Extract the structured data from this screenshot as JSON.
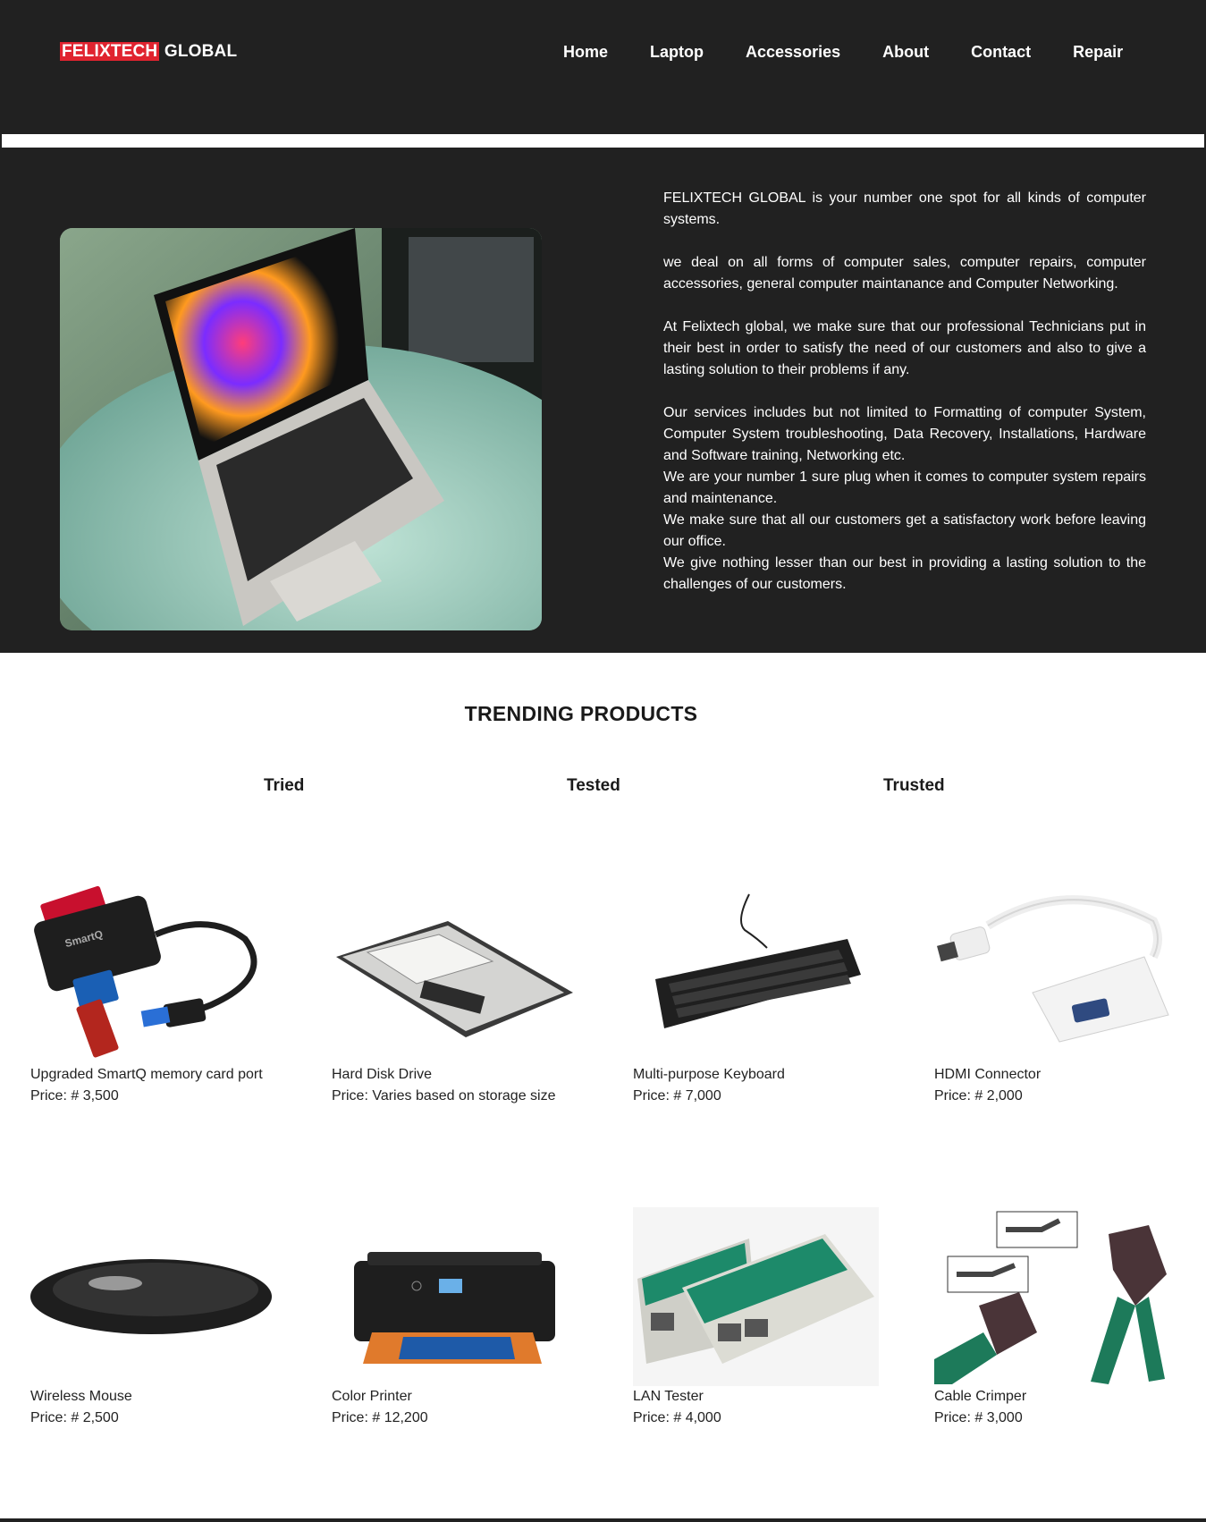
{
  "header": {
    "logo_brand": "FELIXTECH",
    "logo_rest": "GLOBAL",
    "nav": [
      "Home",
      "Laptop",
      "Accessories",
      "About",
      "Contact",
      "Repair"
    ]
  },
  "hero": {
    "paragraphs": [
      "FELIXTECH GLOBAL is your number one spot for all kinds of computer systems.",
      "we deal on all forms of computer sales, computer repairs, computer accessories, general computer maintanance and Computer Networking.",
      "At Felixtech global, we make sure that our professional Technicians put in their best in order to satisfy the need of our customers and also to give a lasting solution to their problems if any.",
      "Our services includes but not limited to Formatting of computer System, Computer System troubleshooting, Data Recovery, Installations, Hardware and Software training, Networking etc.",
      "We are your number 1 sure plug when it comes to computer system repairs and maintenance.",
      "We make sure that all our customers get a satisfactory work before leaving our office.",
      "We give nothing lesser than our best in providing a lasting solution to the challenges of our customers."
    ]
  },
  "products": {
    "title": "TRENDING PRODUCTS",
    "tags": [
      "Tried",
      "Tested",
      "Trusted"
    ],
    "items": [
      {
        "name": "Upgraded SmartQ memory card port",
        "price": "Price: # 3,500",
        "icon": "card-reader-icon"
      },
      {
        "name": "Hard Disk Drive",
        "price": "Price: Varies based on storage size",
        "icon": "hard-disk-icon"
      },
      {
        "name": "Multi-purpose Keyboard",
        "price": "Price: # 7,000",
        "icon": "keyboard-icon"
      },
      {
        "name": "HDMI Connector",
        "price": "Price: # 2,000",
        "icon": "hdmi-adapter-icon"
      },
      {
        "name": "Wireless Mouse",
        "price": "Price: # 2,500",
        "icon": "mouse-icon"
      },
      {
        "name": "Color Printer",
        "price": "Price: # 12,200",
        "icon": "printer-icon"
      },
      {
        "name": "LAN Tester",
        "price": "Price: # 4,000",
        "icon": "lan-tester-icon"
      },
      {
        "name": "Cable Crimper",
        "price": "Price: # 3,000",
        "icon": "crimper-icon"
      }
    ]
  }
}
